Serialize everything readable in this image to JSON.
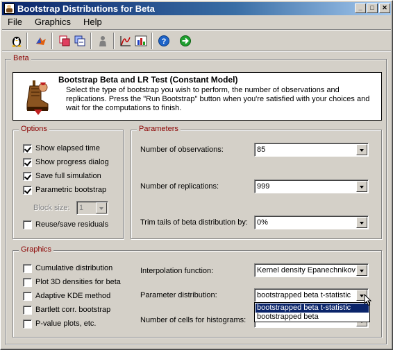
{
  "window": {
    "title": "Bootstrap Distributions for Beta",
    "controls": {
      "minimize": "_",
      "maximize": "□",
      "close": "✕"
    }
  },
  "menu": [
    "File",
    "Graphics",
    "Help"
  ],
  "toolbar": {
    "icons": [
      "tux-icon",
      "matlab-icon",
      "copy-icon",
      "paste-icon",
      "figure-icon",
      "plot-icon",
      "chart-icon",
      "help-icon",
      "run-icon"
    ]
  },
  "beta_group": {
    "legend": "Beta",
    "info_title": "Bootstrap Beta and LR Test (Constant Model)",
    "info_text": "Select the type of bootstrap you wish to perform, the number of observations and replications. Press the \"Run Bootstrap\" button when you're satisfied with your choices and wait for the computations to finish."
  },
  "options": {
    "legend": "Options",
    "checkboxes": [
      {
        "label": "Show elapsed time",
        "checked": true
      },
      {
        "label": "Show progress dialog",
        "checked": true
      },
      {
        "label": "Save full simulation",
        "checked": true
      },
      {
        "label": "Parametric bootstrap",
        "checked": true
      }
    ],
    "block_size_label": "Block size:",
    "block_size_value": "1",
    "reuse_label": "Reuse/save residuals",
    "reuse_checked": false
  },
  "parameters": {
    "legend": "Parameters",
    "observations_label": "Number of observations:",
    "observations_value": "85",
    "replications_label": "Number of replications:",
    "replications_value": "999",
    "trim_label": "Trim tails of beta distribution by:",
    "trim_value": "0%"
  },
  "graphics": {
    "legend": "Graphics",
    "checkboxes": [
      {
        "label": "Cumulative distribution",
        "checked": false
      },
      {
        "label": "Plot 3D densities for beta",
        "checked": false
      },
      {
        "label": "Adaptive KDE method",
        "checked": false
      },
      {
        "label": "Bartlett corr. bootstrap",
        "checked": false
      },
      {
        "label": "P-value plots, etc.",
        "checked": false
      }
    ],
    "interp_label": "Interpolation function:",
    "interp_value": "Kernel density Epanechnikov",
    "param_dist_label": "Parameter distribution:",
    "param_dist_value": "bootstrapped beta t-statistic",
    "param_dist_options": [
      "bootstrapped beta t-statistic",
      "bootstrapped beta"
    ],
    "cells_label": "Number of cells for histograms:"
  },
  "colors": {
    "titlebar": "#0a246a",
    "legend": "#8b0000",
    "selection": "#0a246a",
    "face": "#d4d0c8"
  }
}
